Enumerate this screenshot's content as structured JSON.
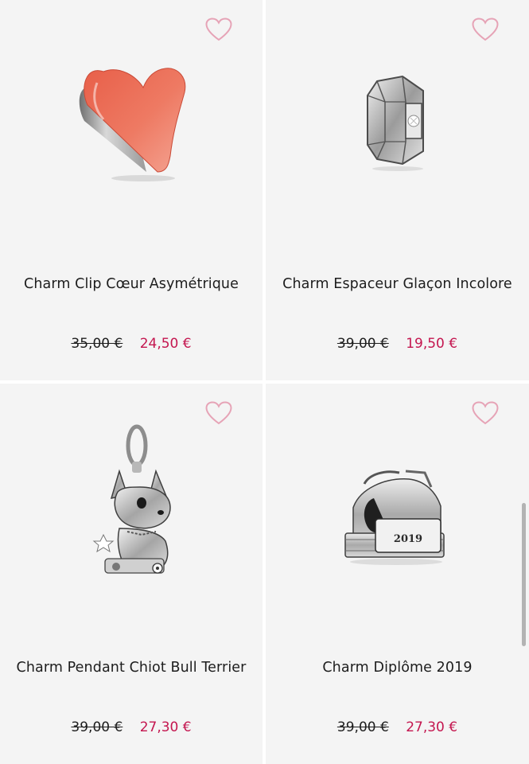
{
  "colors": {
    "card_bg": "#f4f4f4",
    "sale_price": "#c4164f",
    "heart_outline": "#e6a3b6"
  },
  "products": [
    {
      "name": "Charm Clip Cœur Asymétrique",
      "old_price": "35,00 €",
      "new_price": "24,50 €",
      "image_icon": "red-heart-clip-charm"
    },
    {
      "name": "Charm Espaceur Glaçon Incolore",
      "old_price": "39,00 €",
      "new_price": "19,50 €",
      "image_icon": "ice-cube-spacer-charm"
    },
    {
      "name": "Charm Pendant Chiot Bull Terrier",
      "old_price": "39,00 €",
      "new_price": "27,30 €",
      "image_icon": "bull-terrier-pendant-charm"
    },
    {
      "name": "Charm Diplôme 2019",
      "old_price": "39,00 €",
      "new_price": "27,30 €",
      "diploma_year": "2019",
      "image_icon": "diploma-books-charm"
    }
  ]
}
